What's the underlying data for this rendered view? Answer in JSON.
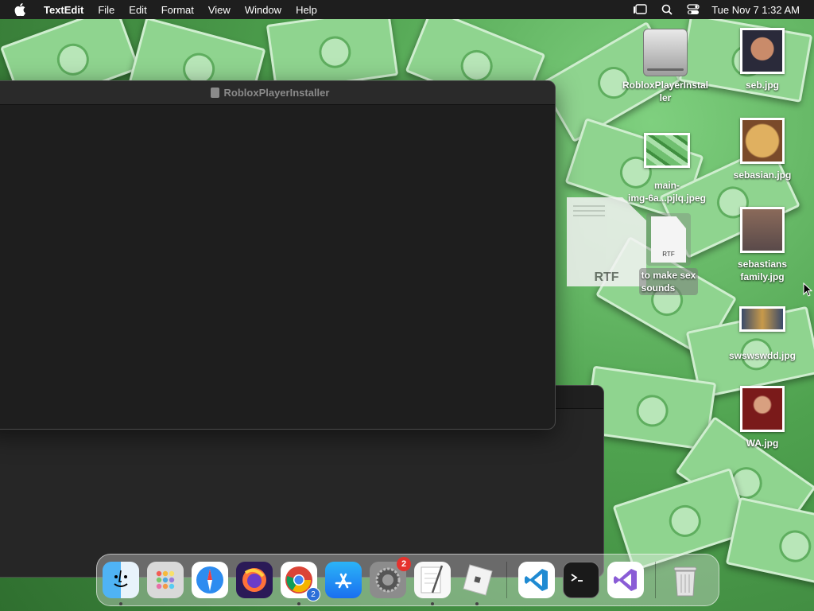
{
  "menubar": {
    "app_name": "TextEdit",
    "menus": [
      "File",
      "Edit",
      "Format",
      "View",
      "Window",
      "Help"
    ],
    "clock": "Tue Nov 7  1:32 AM"
  },
  "front_window": {
    "title": "RobloxPlayerInstaller"
  },
  "desktop": {
    "roblox_installer": "RobloxPlayerInstal\nler",
    "main_img": "main-\nimg-6a...pjlq.jpeg",
    "rtf_file": "to make sex\nsounds",
    "rtf_tag": "RTF",
    "ghost_tag": "RTF",
    "seb": "seb.jpg",
    "sebasian": "sebasian.jpg",
    "sebastians_family": "sebastians\nfamily.jpg",
    "swswswdd": "swswswdd.jpg",
    "wa": "WA.jpg"
  },
  "dock": {
    "settings_badge": "2",
    "chrome_badge": "2",
    "items": [
      "Finder",
      "Launchpad",
      "Safari",
      "Firefox",
      "Chrome",
      "App Store",
      "System Settings",
      "TextEdit",
      "Roblox",
      "Visual Studio Code",
      "Terminal",
      "Visual Studio",
      "Trash"
    ]
  }
}
